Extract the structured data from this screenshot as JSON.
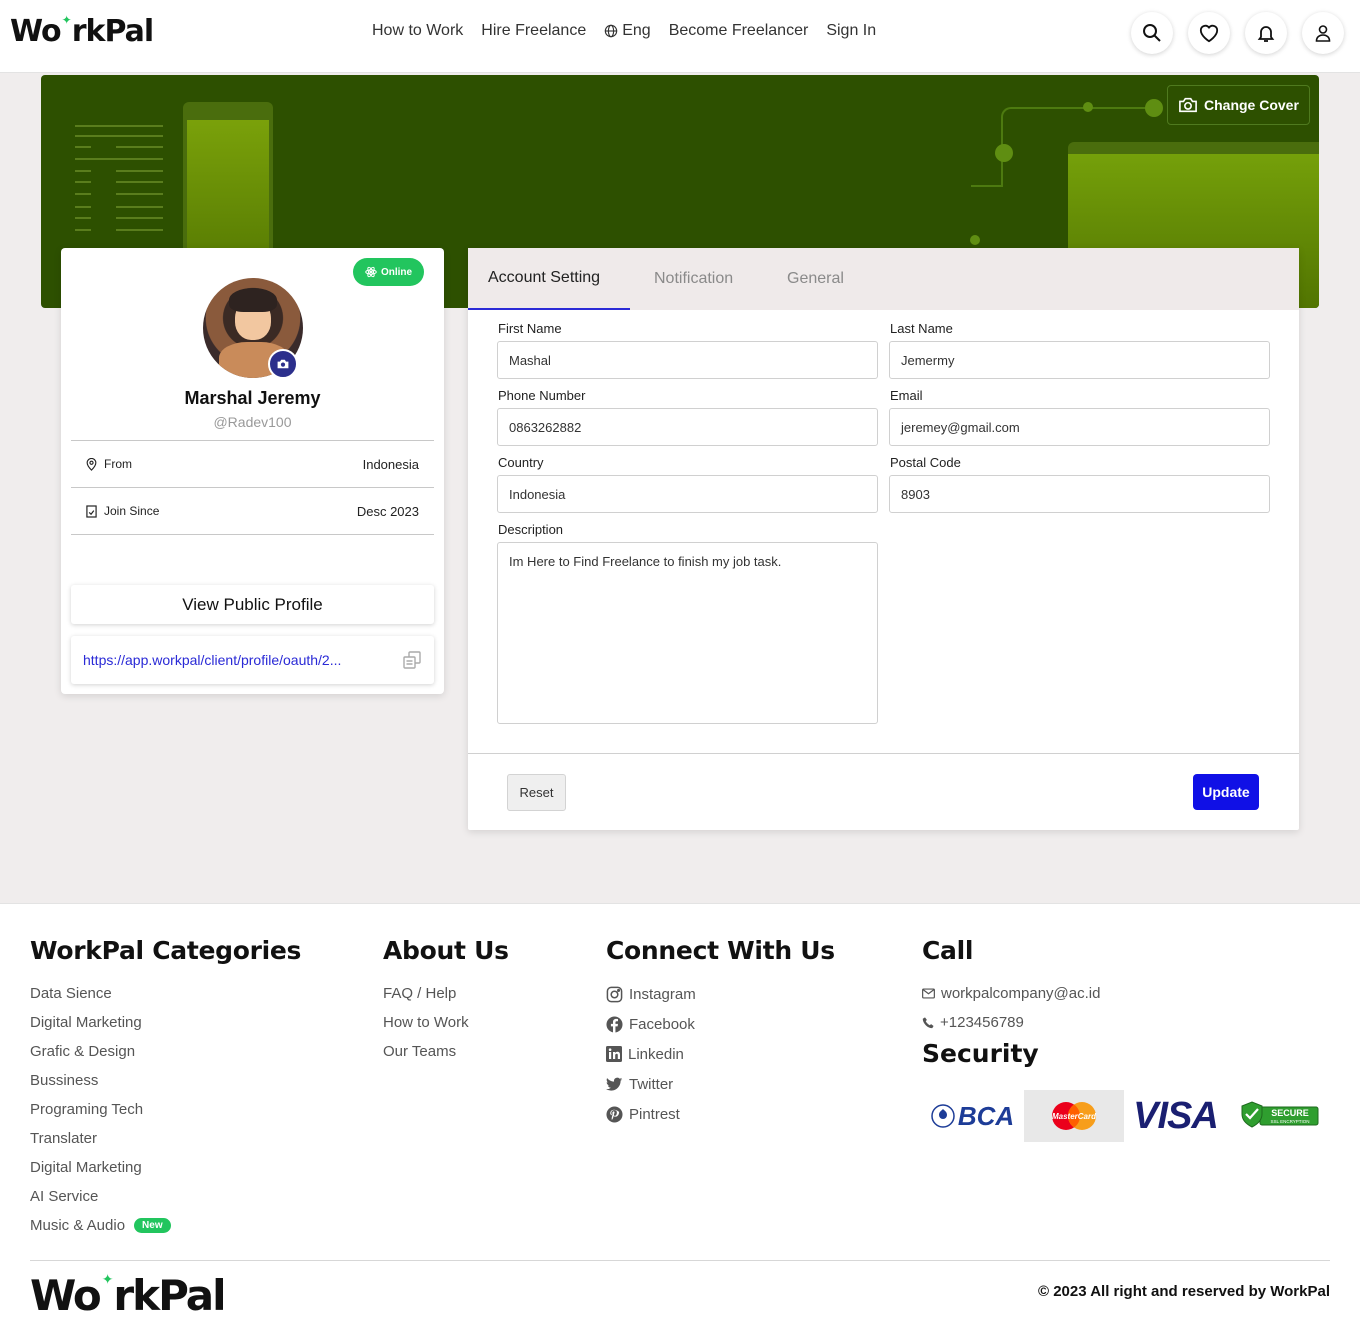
{
  "header": {
    "logo_left": "Wo",
    "logo_right": "rkPal",
    "nav": [
      "How to Work",
      "Hire Freelance",
      "Eng",
      "Become Freelancer",
      "Sign In"
    ]
  },
  "cover": {
    "change_label": "Change Cover"
  },
  "profile": {
    "status": "Online",
    "name": "Marshal Jeremy",
    "username": "@Radev100",
    "from_label": "From",
    "from_value": "Indonesia",
    "join_label": "Join Since",
    "join_value": "Desc 2023",
    "view_label": "View Public Profile",
    "link": "https://app.workpal/client/profile/oauth/2..."
  },
  "settings": {
    "tabs": [
      "Account Setting",
      "Notification",
      "General"
    ],
    "first_name_label": "First Name",
    "first_name": "Mashal",
    "last_name_label": "Last Name",
    "last_name": "Jemermy",
    "phone_label": "Phone Number",
    "phone": "0863262882",
    "email_label": "Email",
    "email": "jeremey@gmail.com",
    "country_label": "Country",
    "country": "Indonesia",
    "postal_label": "Postal Code",
    "postal": "8903",
    "description_label": "Description",
    "description": "Im Here to Find Freelance to finish my job task.",
    "reset_label": "Reset",
    "update_label": "Update"
  },
  "footer": {
    "categories_title": "WorkPal Categories",
    "categories": [
      "Data Sience",
      "Digital Marketing",
      "Grafic & Design",
      "Bussiness",
      "Programing Tech",
      "Translater",
      "Digital Marketing",
      "AI Service",
      "Music & Audio"
    ],
    "new_badge": "New",
    "about_title": "About Us",
    "about": [
      "FAQ / Help",
      "How to Work",
      "Our Teams"
    ],
    "connect_title": "Connect With Us",
    "connect": [
      "Instagram",
      "Facebook",
      "Linkedin",
      "Twitter",
      "Pintrest"
    ],
    "call_title": "Call",
    "email": "workpalcompany@ac.id",
    "phone": "+123456789",
    "security_title": "Security",
    "bca": "BCA",
    "mastercard": "MasterCard",
    "visa": "VISA",
    "ssl_top": "SECURE",
    "ssl_bottom": "SSL ENCRYPTION",
    "copyright": "© 2023 All right and reserved by WorkPal"
  },
  "colors": {
    "accent": "#1010e6",
    "online": "#22c55e",
    "cover": "#2d5000",
    "link": "#2a2ad6"
  }
}
